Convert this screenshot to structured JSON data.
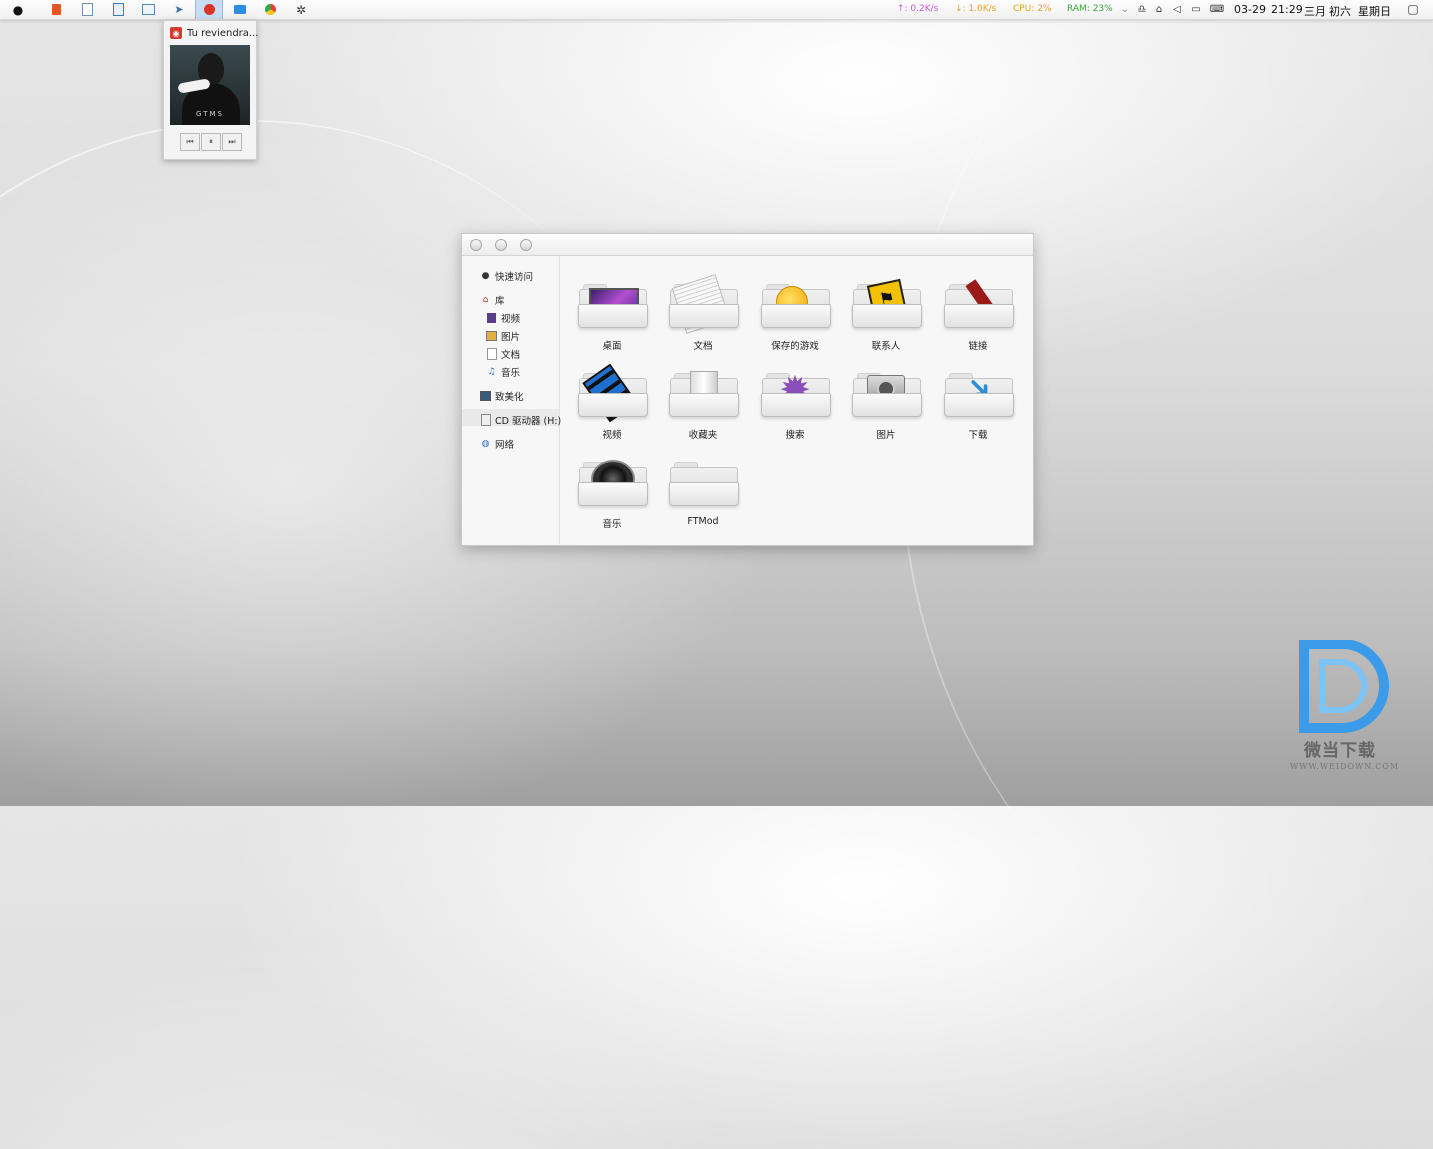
{
  "taskbar": {
    "apps": [
      {
        "icon": "apple-icon"
      },
      {
        "icon": "office-icon"
      },
      {
        "icon": "document-icon"
      },
      {
        "icon": "notes-icon"
      },
      {
        "icon": "image-icon"
      },
      {
        "icon": "send-icon"
      },
      {
        "icon": "netease-music-icon",
        "active": true
      },
      {
        "icon": "folder-icon"
      },
      {
        "icon": "chrome-icon"
      },
      {
        "icon": "gear-icon"
      }
    ],
    "upload": "↑: 0.2K/s",
    "download": "↓: 1.0K/s",
    "cpu": "CPU: 2%",
    "ram": "RAM: 23%",
    "date": "03-29",
    "time": "21:29",
    "lunar_month": "三月",
    "lunar_day": "初六",
    "weekday": "星期日",
    "colors": {
      "upload": "#c65ad8",
      "download": "#f0a020",
      "cpu": "#e8a020",
      "ram": "#3aa63a"
    }
  },
  "music": {
    "title": "Tu reviendra...",
    "cover_text": "GTMS",
    "controls": [
      "previous-icon",
      "pause-icon",
      "next-icon"
    ]
  },
  "sidebar": {
    "quick_access": "快速访问",
    "library": "库",
    "videos": "视频",
    "pictures": "图片",
    "documents": "文档",
    "music": "音乐",
    "this_pc": "致美化",
    "cd_drive": "CD 驱动器 (H:)",
    "network": "网络"
  },
  "items": [
    {
      "label": "桌面",
      "icon": "desktop-folder-icon"
    },
    {
      "label": "文档",
      "icon": "documents-folder-icon"
    },
    {
      "label": "保存的游戏",
      "icon": "saved-games-folder-icon"
    },
    {
      "label": "联系人",
      "icon": "contacts-folder-icon"
    },
    {
      "label": "链接",
      "icon": "links-folder-icon"
    },
    {
      "label": "视频",
      "icon": "videos-folder-icon"
    },
    {
      "label": "收藏夹",
      "icon": "favorites-folder-icon"
    },
    {
      "label": "搜索",
      "icon": "searches-folder-icon"
    },
    {
      "label": "图片",
      "icon": "pictures-folder-icon"
    },
    {
      "label": "下载",
      "icon": "downloads-folder-icon"
    },
    {
      "label": "音乐",
      "icon": "music-folder-icon"
    },
    {
      "label": "FTMod",
      "icon": "plain-folder-icon"
    }
  ],
  "watermark": {
    "name": "微当下载",
    "url": "WWW.WEIDOWN.COM"
  }
}
